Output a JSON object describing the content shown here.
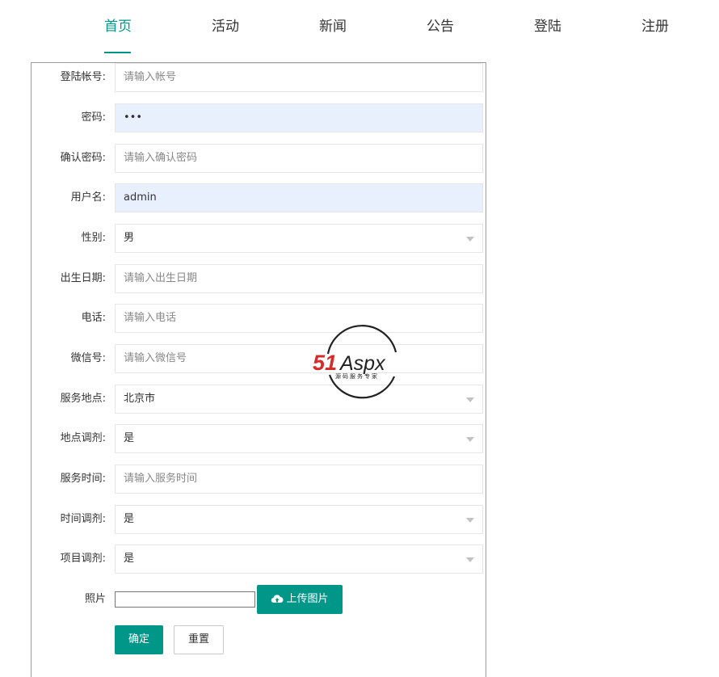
{
  "nav": {
    "items": [
      {
        "label": "首页",
        "active": true
      },
      {
        "label": "活动",
        "active": false
      },
      {
        "label": "新闻",
        "active": false
      },
      {
        "label": "公告",
        "active": false
      },
      {
        "label": "登陆",
        "active": false
      },
      {
        "label": "注册",
        "active": false
      }
    ]
  },
  "form": {
    "account": {
      "label": "登陆帐号:",
      "placeholder": "请输入帐号",
      "value": ""
    },
    "password": {
      "label": "密码:",
      "value": "•••"
    },
    "confirm_password": {
      "label": "确认密码:",
      "placeholder": "请输入确认密码",
      "value": ""
    },
    "username": {
      "label": "用户名:",
      "value": "admin"
    },
    "gender": {
      "label": "性别:",
      "value": "男"
    },
    "birthday": {
      "label": "出生日期:",
      "placeholder": "请输入出生日期",
      "value": ""
    },
    "phone": {
      "label": "电话:",
      "placeholder": "请输入电话",
      "value": ""
    },
    "wechat": {
      "label": "微信号:",
      "placeholder": "请输入微信号",
      "value": ""
    },
    "service_location": {
      "label": "服务地点:",
      "value": "北京市"
    },
    "location_adjust": {
      "label": "地点调剂:",
      "value": "是"
    },
    "service_time": {
      "label": "服务时间:",
      "placeholder": "请输入服务时间",
      "value": ""
    },
    "time_adjust": {
      "label": "时间调剂:",
      "value": "是"
    },
    "project_adjust": {
      "label": "项目调剂:",
      "value": "是"
    },
    "photo": {
      "label": "照片",
      "upload_label": "上传图片"
    },
    "submit_label": "确定",
    "reset_label": "重置"
  },
  "watermark": {
    "brand": "51Aspx",
    "tagline": "源码服务专家"
  },
  "colors": {
    "accent": "#009688",
    "autofill": "#e8f0fe"
  }
}
